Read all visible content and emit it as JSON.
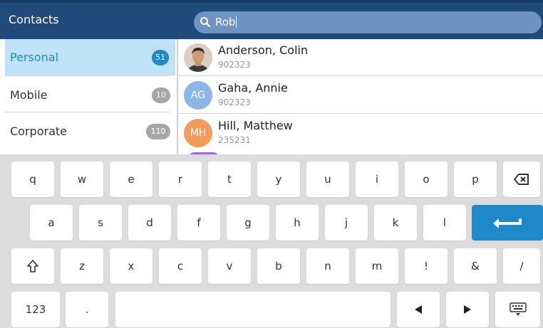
{
  "header": {
    "title": "Contacts",
    "search_value": "Rob"
  },
  "categories": [
    {
      "label": "Personal",
      "count": "51",
      "selected": true
    },
    {
      "label": "Mobile",
      "count": "10",
      "selected": false
    },
    {
      "label": "Corporate",
      "count": "110",
      "selected": false
    }
  ],
  "contacts": [
    {
      "name": "Anderson, Colin",
      "number": "902323",
      "initials": "",
      "avatar": "photo"
    },
    {
      "name": "Gaha, Annie",
      "number": "902323",
      "initials": "AG",
      "avatar_color": "#8ab6e8"
    },
    {
      "name": "Hill, Matthew",
      "number": "235231",
      "initials": "MH",
      "avatar_color": "#f39b5a"
    }
  ],
  "keyboard": {
    "row1": [
      "q",
      "w",
      "e",
      "r",
      "t",
      "y",
      "u",
      "i",
      "o",
      "p"
    ],
    "row2": [
      "a",
      "s",
      "d",
      "f",
      "g",
      "h",
      "j",
      "k",
      "l"
    ],
    "row3": [
      "z",
      "x",
      "c",
      "v",
      "b",
      "n",
      "m",
      "!",
      "&",
      "/"
    ],
    "numbers_label": "123",
    "period_label": ".",
    "icons": {
      "backspace": "backspace-icon",
      "enter": "enter-icon",
      "shift": "shift-icon",
      "left": "arrow-left-icon",
      "right": "arrow-right-icon",
      "hide": "keyboard-hide-icon"
    }
  },
  "colors": {
    "header_bg": "#1f4a7a",
    "accent": "#1f89c9",
    "selected_bg": "#bfe2f6"
  }
}
